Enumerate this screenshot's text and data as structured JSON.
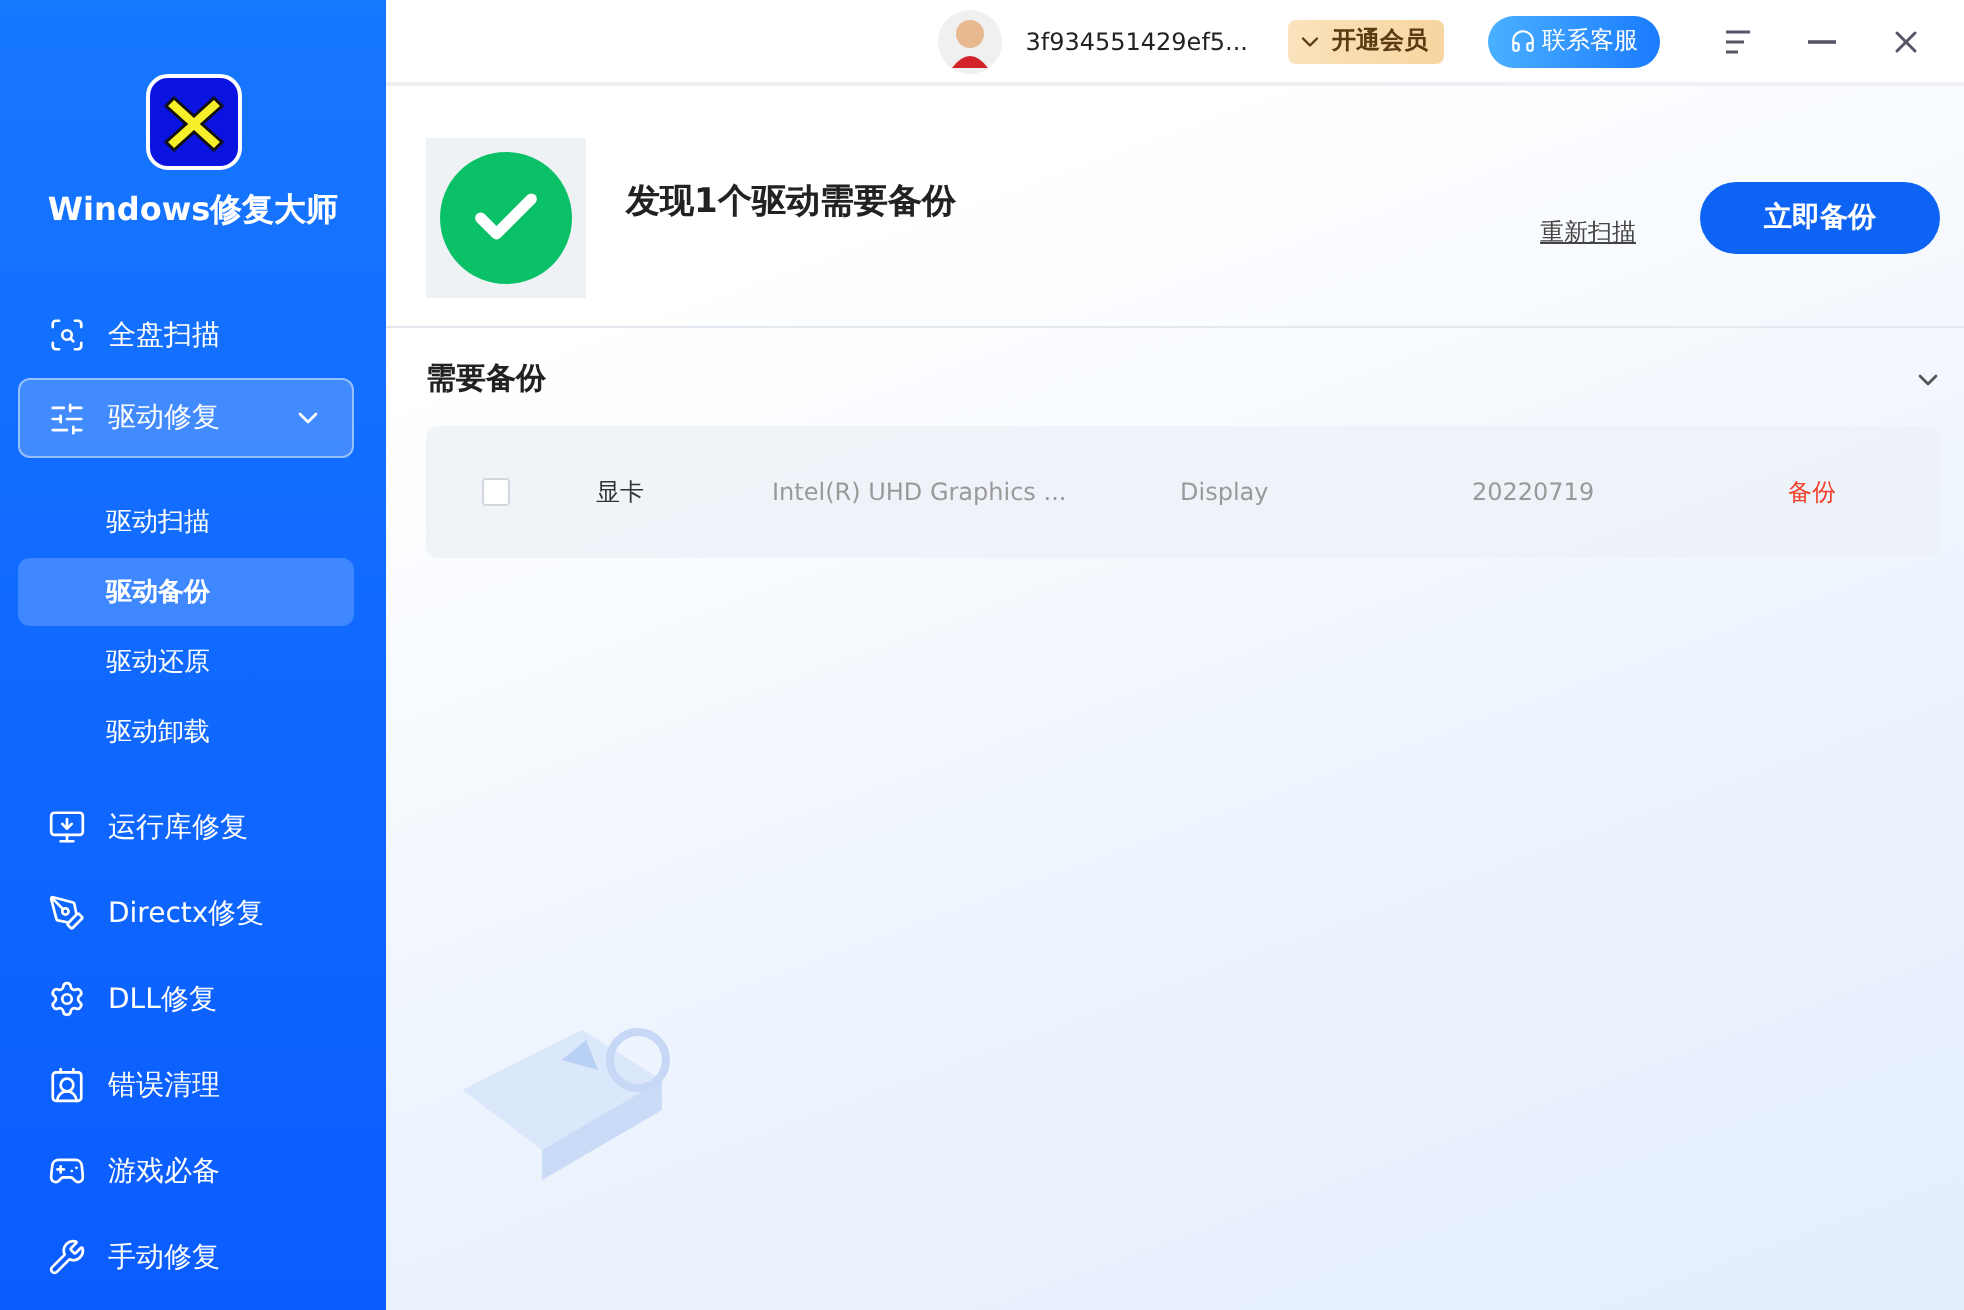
{
  "app": {
    "name": "Windows修复大师"
  },
  "sidebar": {
    "items": [
      {
        "label": "全盘扫描",
        "selected": false
      },
      {
        "label": "驱动修复",
        "selected": true,
        "expanded": true,
        "children": [
          {
            "label": "驱动扫描",
            "selected": false
          },
          {
            "label": "驱动备份",
            "selected": true
          },
          {
            "label": "驱动还原",
            "selected": false
          },
          {
            "label": "驱动卸载",
            "selected": false
          }
        ]
      },
      {
        "label": "运行库修复",
        "selected": false
      },
      {
        "label": "Directx修复",
        "selected": false
      },
      {
        "label": "DLL修复",
        "selected": false
      },
      {
        "label": "错误清理",
        "selected": false
      },
      {
        "label": "游戏必备",
        "selected": false
      },
      {
        "label": "手动修复",
        "selected": false
      }
    ]
  },
  "titlebar": {
    "user": "3f934551429ef5...",
    "vip": "开通会员",
    "support": "联系客服"
  },
  "result": {
    "title": "发现1个驱动需要备份",
    "rescan": "重新扫描",
    "action": "立即备份"
  },
  "section": {
    "title": "需要备份",
    "expanded": true,
    "rows": [
      {
        "checked": false,
        "type": "显卡",
        "name": "Intel(R) UHD Graphics ...",
        "category": "Display",
        "date": "20220719",
        "action": "备份"
      }
    ]
  }
}
